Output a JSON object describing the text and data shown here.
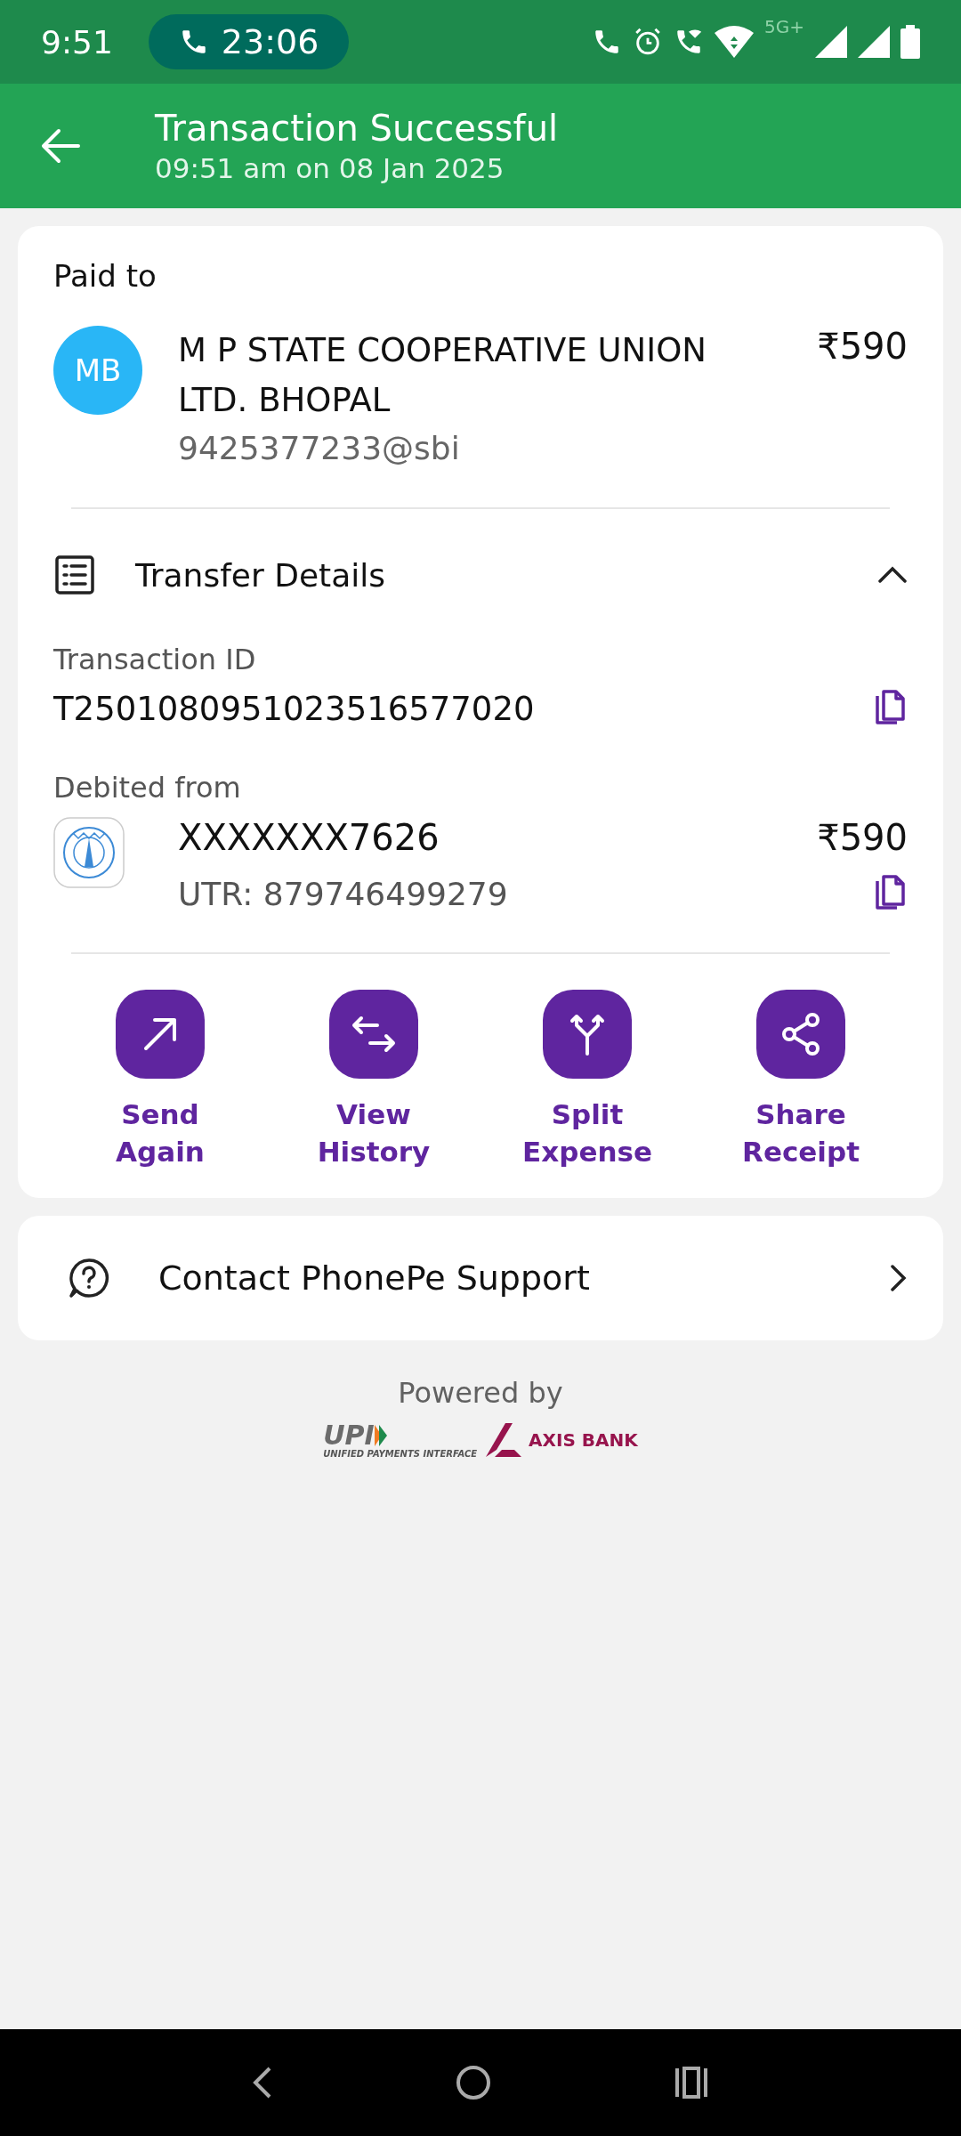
{
  "status_bar": {
    "time": "9:51",
    "call_timer": "23:06",
    "network_label": "5G+"
  },
  "header": {
    "title": "Transaction Successful",
    "subtitle": "09:51 am on 08 Jan 2025"
  },
  "paid_to": {
    "label": "Paid to",
    "avatar_initials": "MB",
    "name": "M P STATE COOPERATIVE UNION LTD. BHOPAL",
    "upi_id": "9425377233@sbi",
    "amount": "₹590"
  },
  "transfer_details": {
    "title": "Transfer Details",
    "expanded": true,
    "transaction_id_label": "Transaction ID",
    "transaction_id": "T2501080951023516577020",
    "debited_from_label": "Debited from",
    "account": "XXXXXXX7626",
    "amount": "₹590",
    "utr": "UTR: 879746499279"
  },
  "actions": [
    {
      "kind": "send",
      "label": "Send Again"
    },
    {
      "kind": "history",
      "label": "View History"
    },
    {
      "kind": "split",
      "label": "Split Expense"
    },
    {
      "kind": "share",
      "label": "Share Receipt"
    }
  ],
  "support": {
    "label": "Contact PhonePe Support"
  },
  "footer": {
    "powered_by": "Powered by",
    "upi_logo": "UPI",
    "upi_tagline": "UNIFIED PAYMENTS INTERFACE",
    "bank_name": "AXIS BANK"
  }
}
